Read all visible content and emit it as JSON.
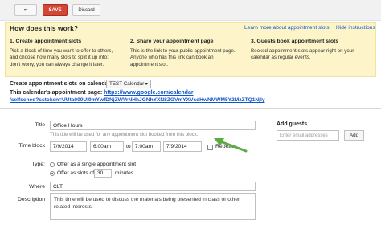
{
  "toolbar": {
    "back_label": "⬅",
    "save_label": "SAVE",
    "discard_label": "Discard"
  },
  "help": {
    "title": "How does this work?",
    "learn_more": "Learn more about appointment slots",
    "hide": "Hide instructions",
    "steps": [
      {
        "heading": "1. Create appointment slots",
        "body": [
          "Pick a block of time you want to offer to others,",
          "and choose how many slots to split it up into;",
          "don't worry, you can always change it later."
        ]
      },
      {
        "heading": "2. Share your appointment page",
        "body": [
          "This is the link to your public appointment page.",
          "Anyone who has this link can book an",
          "appointment slot."
        ]
      },
      {
        "heading": "3. Guests book appointment slots",
        "body": [
          "Booked appointment slots appear right on your",
          "calendar as regular events."
        ]
      }
    ]
  },
  "calendar": {
    "label": "Create appointment slots on calendar:",
    "selected": "TEST Calendar",
    "page_label": "This calendar's appointment page:",
    "url_line1": "https://www.google.com/calendar",
    "url_line2": "/selfsched?sstoken=UUta000UI9mYwfDNjZWVrNHhJGNhYXN8ZGVmYXVsdHwNMWM5Y2MzZTQ1NjIy"
  },
  "form": {
    "title_label": "Title",
    "title_value": "Office Hours",
    "title_hint": "This title will be used for any appointment slot booked from this block.",
    "time_label": "Time block",
    "start_date": "7/9/2014",
    "start_time": "6:00am",
    "to_word": "to",
    "end_time": "7:00am",
    "end_date": "7/9/2014",
    "repeat_label": "Repeat...",
    "type_label": "Type:",
    "option_single": "Offer as a single appointment slot",
    "option_slots_prefix": "Offer as slots of:",
    "slot_minutes": "30",
    "minutes_word": "minutes",
    "where_label": "Where",
    "where_value": "CLT",
    "description_label": "Description",
    "description_value": "This time will be used to discuss the materials being presented in class or other related interests."
  },
  "guests": {
    "label": "Add guests",
    "placeholder": "Enter email addresses",
    "add_label": "Add"
  },
  "colors": {
    "save_red": "#d14836",
    "help_bg": "#fdf5c9",
    "link_blue": "#1155cc",
    "arrow_green": "#5cab45"
  }
}
